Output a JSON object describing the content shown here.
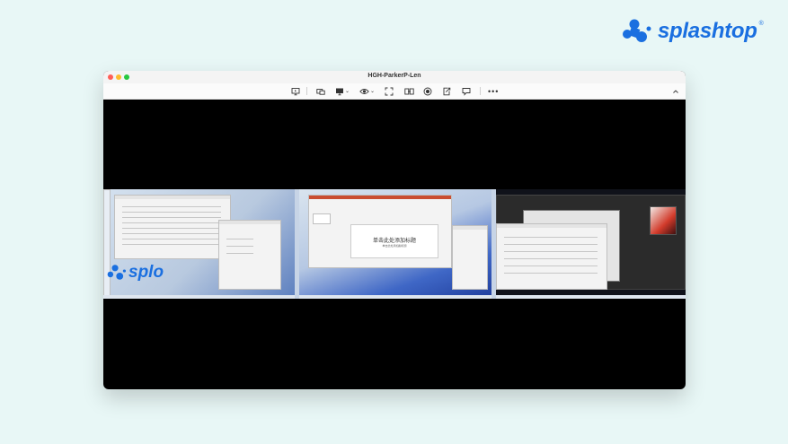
{
  "brand": {
    "name": "splashtop",
    "registered_mark": "®",
    "color": "#1a6fe0"
  },
  "window": {
    "title": "HGH-ParkerP-Len"
  },
  "toolbar": {
    "items": [
      {
        "icon": "monitor-icon"
      },
      {
        "icon": "switch-screen-icon"
      },
      {
        "icon": "multi-monitor-icon",
        "caret": "⌄"
      },
      {
        "icon": "eye-icon",
        "caret": "⌄"
      },
      {
        "icon": "fullscreen-icon"
      },
      {
        "icon": "file-transfer-icon"
      },
      {
        "icon": "record-icon"
      },
      {
        "icon": "share-icon"
      },
      {
        "icon": "chat-icon"
      }
    ],
    "more_label": "•••",
    "collapse_icon": "chevron-up-icon"
  },
  "remote_desktop": {
    "monitor_2": {
      "slide_title": "单击此处添加标题",
      "slide_subtitle": "单击此处添加副标题"
    },
    "monitor_1": {
      "logo_text": "splo"
    }
  }
}
